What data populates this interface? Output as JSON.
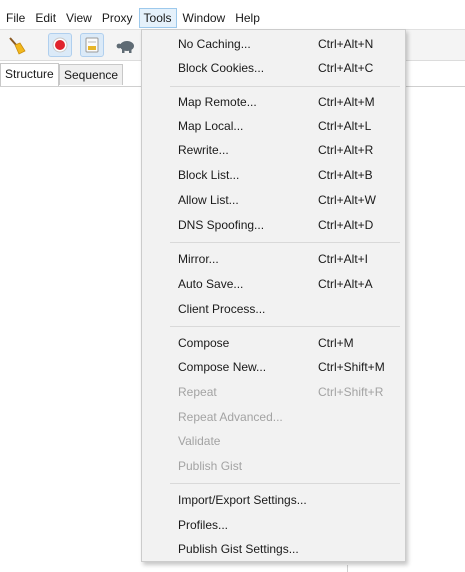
{
  "menubar": {
    "items": [
      "File",
      "Edit",
      "View",
      "Proxy",
      "Tools",
      "Window",
      "Help"
    ]
  },
  "toolbar": {
    "buttons": [
      {
        "icon": "broom-icon"
      },
      {
        "icon": "record-icon",
        "pressed": true
      },
      {
        "icon": "throttle-icon",
        "pressed": true
      },
      {
        "icon": "turtle-icon"
      }
    ]
  },
  "tabs": [
    "Structure",
    "Sequence"
  ],
  "tools_menu": {
    "items": [
      {
        "label": "No Caching...",
        "shortcut": "Ctrl+Alt+N",
        "enabled": true
      },
      {
        "label": "Block Cookies...",
        "shortcut": "Ctrl+Alt+C",
        "enabled": true
      },
      {
        "label": "Map Remote...",
        "shortcut": "Ctrl+Alt+M",
        "enabled": true
      },
      {
        "label": "Map Local...",
        "shortcut": "Ctrl+Alt+L",
        "enabled": true
      },
      {
        "label": "Rewrite...",
        "shortcut": "Ctrl+Alt+R",
        "enabled": true
      },
      {
        "label": "Block List...",
        "shortcut": "Ctrl+Alt+B",
        "enabled": true
      },
      {
        "label": "Allow List...",
        "shortcut": "Ctrl+Alt+W",
        "enabled": true
      },
      {
        "label": "DNS Spoofing...",
        "shortcut": "Ctrl+Alt+D",
        "enabled": true
      },
      {
        "label": "Mirror...",
        "shortcut": "Ctrl+Alt+I",
        "enabled": true
      },
      {
        "label": "Auto Save...",
        "shortcut": "Ctrl+Alt+A",
        "enabled": true
      },
      {
        "label": "Client Process...",
        "shortcut": "",
        "enabled": true
      },
      {
        "label": "Compose",
        "shortcut": "Ctrl+M",
        "enabled": true
      },
      {
        "label": "Compose New...",
        "shortcut": "Ctrl+Shift+M",
        "enabled": true
      },
      {
        "label": "Repeat",
        "shortcut": "Ctrl+Shift+R",
        "enabled": false
      },
      {
        "label": "Repeat Advanced...",
        "shortcut": "",
        "enabled": false
      },
      {
        "label": "Validate",
        "shortcut": "",
        "enabled": false
      },
      {
        "label": "Publish Gist",
        "shortcut": "",
        "enabled": false
      },
      {
        "label": "Import/Export Settings...",
        "shortcut": "",
        "enabled": true
      },
      {
        "label": "Profiles...",
        "shortcut": "",
        "enabled": true
      },
      {
        "label": "Publish Gist Settings...",
        "shortcut": "",
        "enabled": true
      }
    ]
  },
  "colors": {
    "menu_background": "#f2f2f2",
    "active_menu_highlight": "#e5f1fb",
    "disabled_text": "#a3a3a3",
    "record_red": "#e0242e"
  }
}
